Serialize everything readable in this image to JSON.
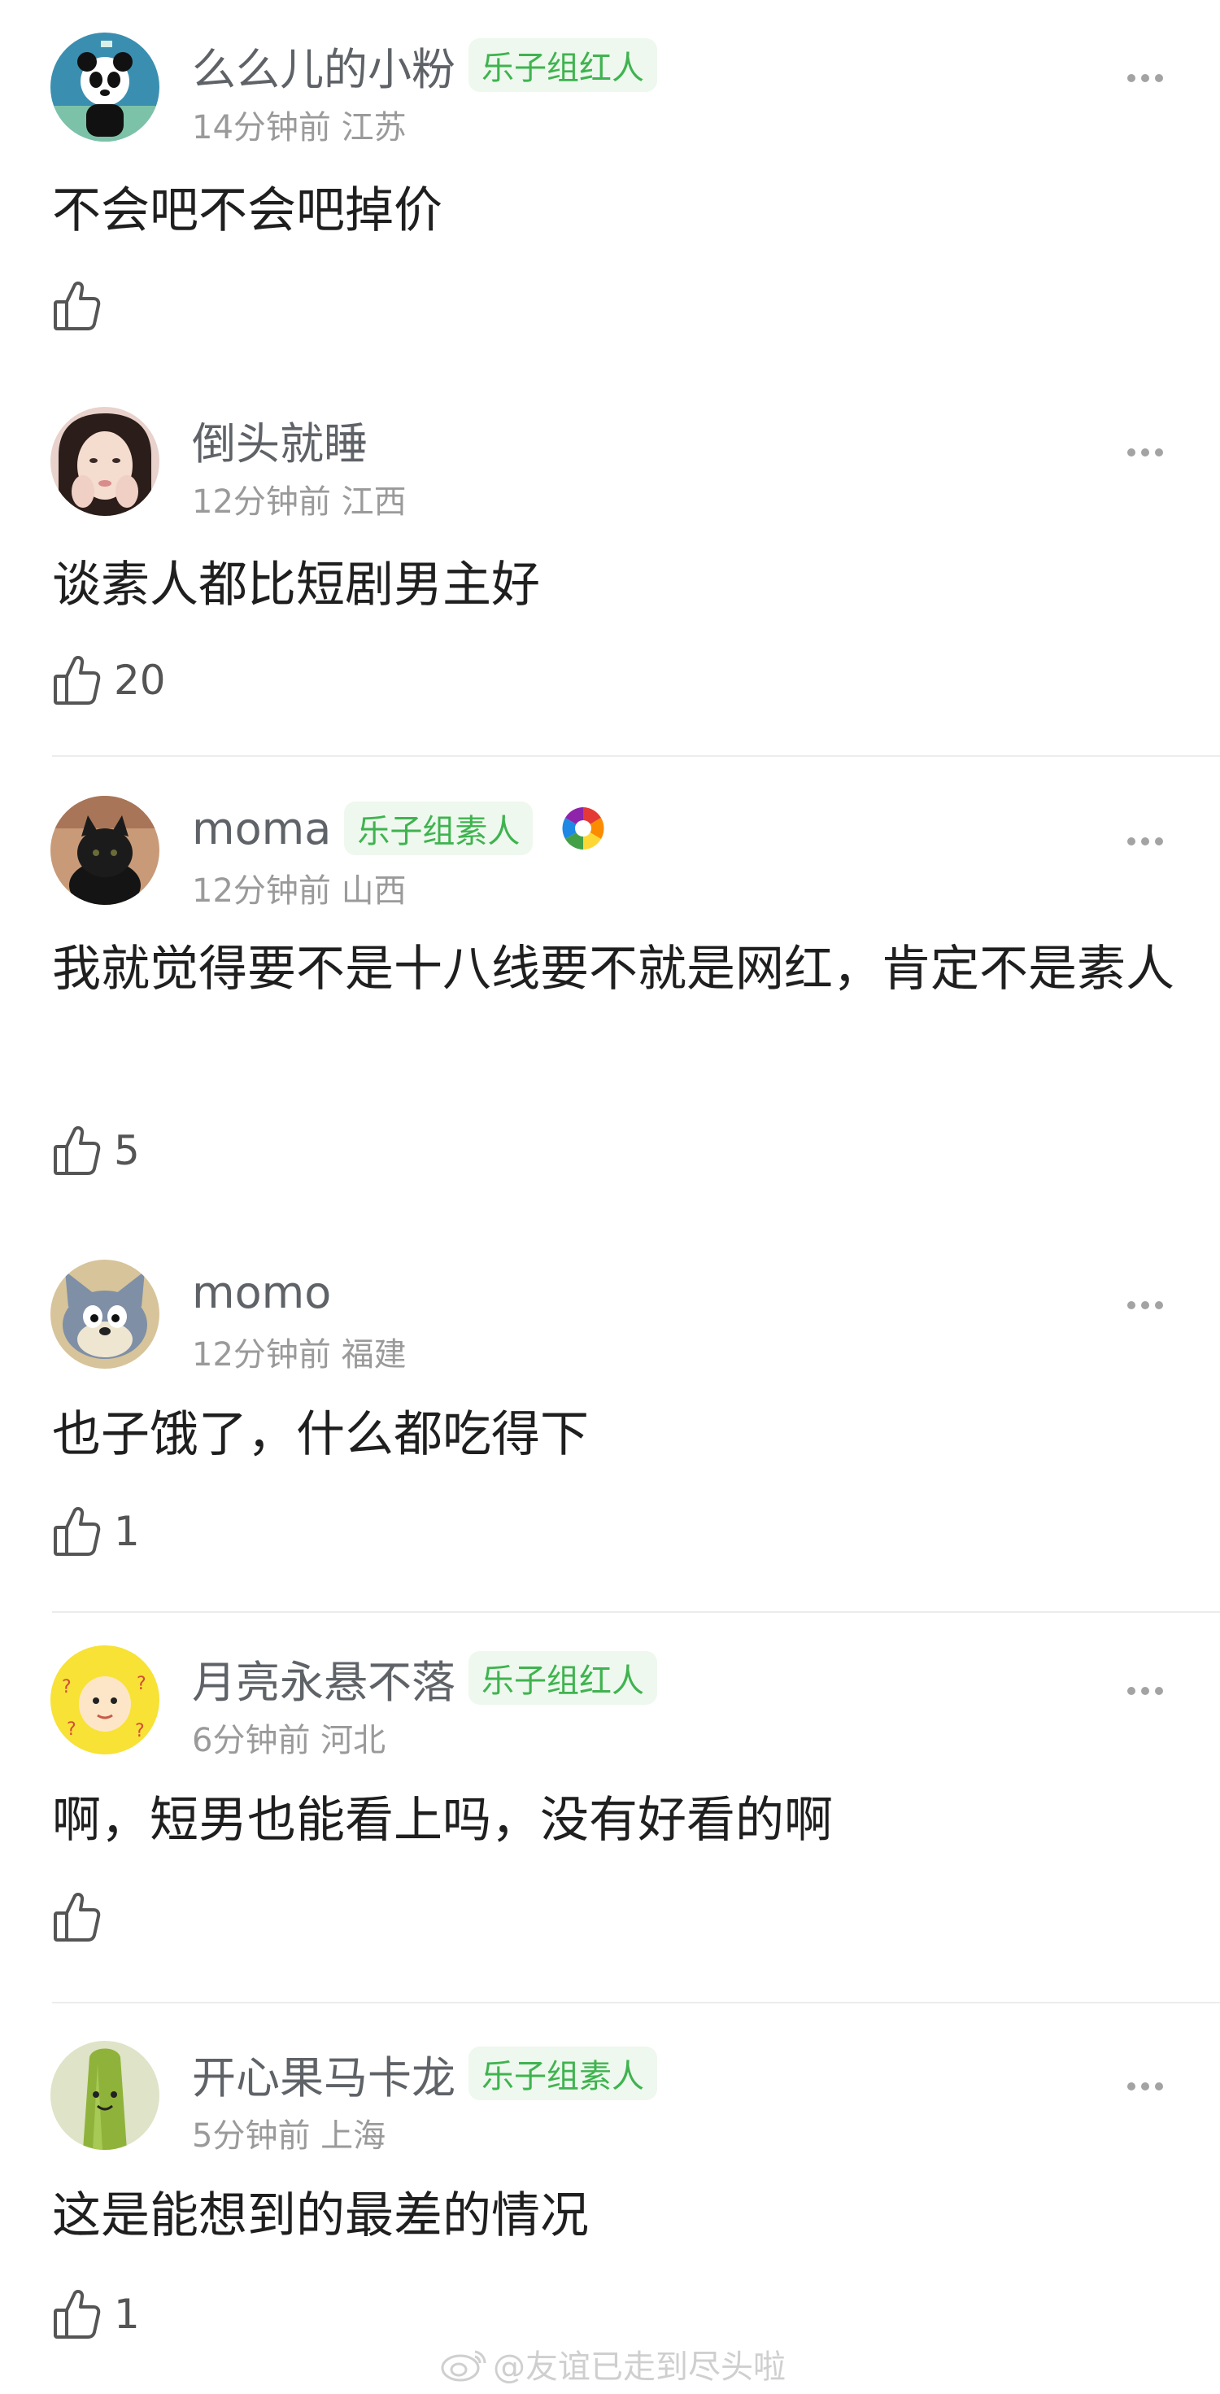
{
  "comments": [
    {
      "username": "么么儿的小粉",
      "tag": "乐子组红人",
      "time": "14分钟前",
      "location": "江苏",
      "text": "不会吧不会吧掉价",
      "likes": "",
      "avatar_icon": "panda-avatar"
    },
    {
      "username": "倒头就睡",
      "tag": "",
      "time": "12分钟前",
      "location": "江西",
      "text": "谈素人都比短剧男主好",
      "likes": "20",
      "avatar_icon": "girl-avatar"
    },
    {
      "username": "moma",
      "tag": "乐子组素人",
      "time": "12分钟前",
      "location": "山西",
      "text": "我就觉得要不是十八线要不就是网红，肯定不是素人",
      "likes": "5",
      "avatar_icon": "black-cat-avatar",
      "badge_icon": "rainbow-badge-icon"
    },
    {
      "username": "momo",
      "tag": "",
      "time": "12分钟前",
      "location": "福建",
      "text": "也子饿了，什么都吃得下",
      "likes": "1",
      "avatar_icon": "cartoon-cat-avatar"
    },
    {
      "username": "月亮永悬不落",
      "tag": "乐子组红人",
      "time": "6分钟前",
      "location": "河北",
      "text": "啊，短男也能看上吗，没有好看的啊",
      "likes": "",
      "avatar_icon": "cartoon-baby-avatar"
    },
    {
      "username": "开心果马卡龙",
      "tag": "乐子组素人",
      "time": "5分钟前",
      "location": "上海",
      "text": "这是能想到的最差的情况",
      "likes": "1",
      "avatar_icon": "green-vegetable-avatar"
    }
  ],
  "watermark": "@友谊已走到尽头啦",
  "colors": {
    "tag_text": "#3fb34f",
    "tag_bg": "#eef8ee",
    "username": "#5f6368",
    "meta": "#9a9a9a"
  }
}
